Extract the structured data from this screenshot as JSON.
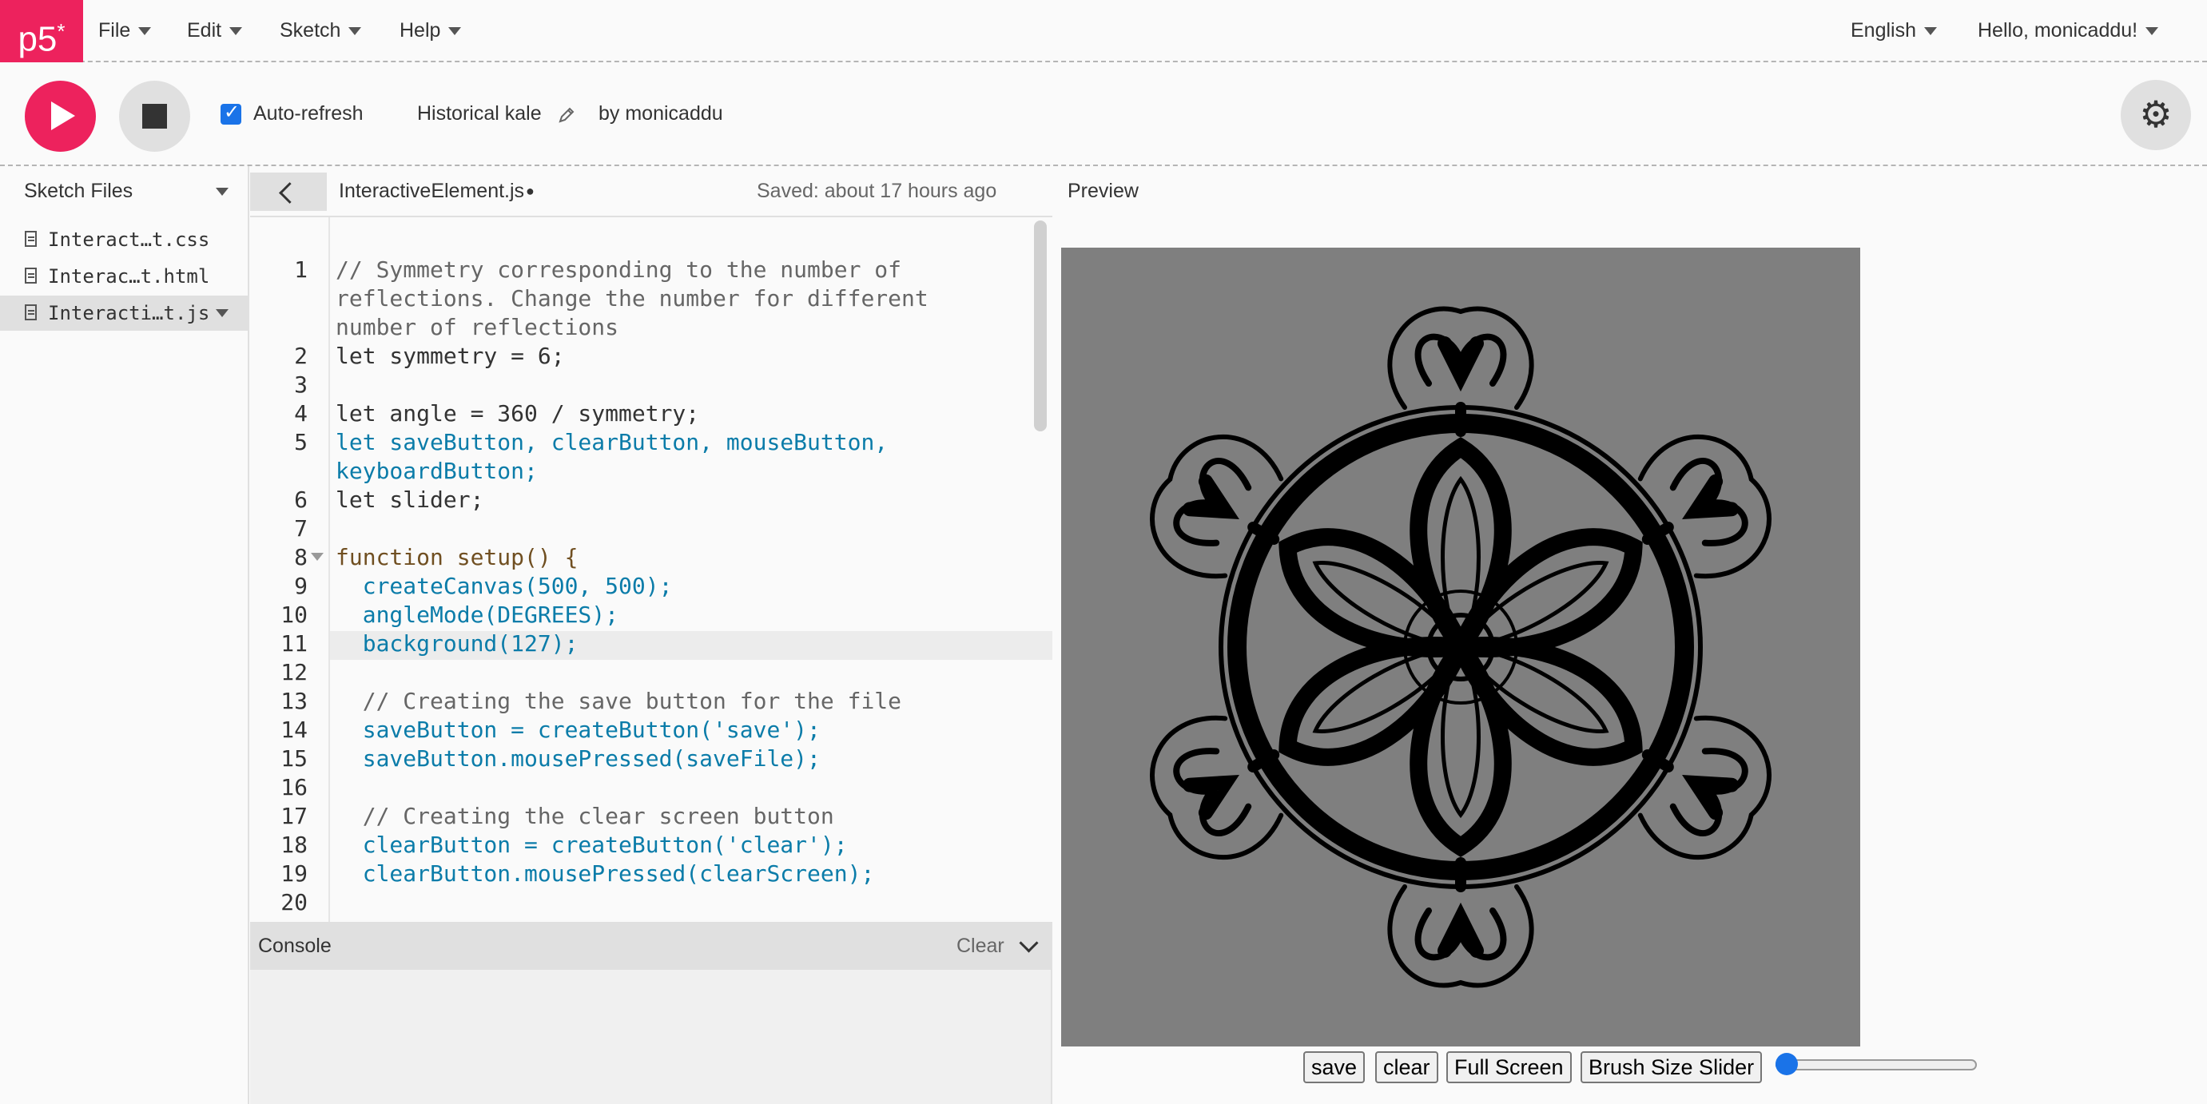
{
  "nav": {
    "logo": "p5",
    "logo_sup": "*",
    "menus": [
      "File",
      "Edit",
      "Sketch",
      "Help"
    ],
    "language": "English",
    "greeting": "Hello, monicaddu!"
  },
  "toolbar": {
    "auto_refresh_label": "Auto-refresh",
    "auto_refresh_checked": true,
    "sketch_name": "Historical kale",
    "author": "by monicaddu"
  },
  "sidebar": {
    "title": "Sketch Files",
    "files": [
      "Interact…t.css",
      "Interac…t.html",
      "Interacti…t.js"
    ],
    "selected_index": 2
  },
  "editor": {
    "filename": "InteractiveElement.js",
    "status": "Saved: about 17 hours ago",
    "line_numbers": [
      "1",
      "2",
      "3",
      "4",
      "5",
      "6",
      "7",
      "8",
      "9",
      "10",
      "11",
      "12",
      "13",
      "14",
      "15",
      "16",
      "17",
      "18",
      "19",
      "20"
    ],
    "lines": [
      "// Symmetry corresponding to the number of",
      "reflections. Change the number for different",
      "number of reflections",
      "let symmetry = 6;",
      "",
      "let angle = 360 / symmetry;",
      "let saveButton, clearButton, mouseButton,",
      "keyboardButton;",
      "let slider;",
      "",
      "function setup() {",
      "  createCanvas(500, 500);",
      "  angleMode(DEGREES);",
      "  background(127);",
      "",
      "  // Creating the save button for the file",
      "  saveButton = createButton('save');",
      "  saveButton.mousePressed(saveFile);",
      "",
      "  // Creating the clear screen button",
      "  clearButton = createButton('clear');",
      "  clearButton.mousePressed(clearScreen);"
    ]
  },
  "console": {
    "title": "Console",
    "clear": "Clear"
  },
  "preview": {
    "title": "Preview",
    "canvas_background": "#7f7f7f",
    "buttons": [
      "save",
      "clear",
      "Full Screen",
      "Brush Size Slider"
    ],
    "slider_value": 0
  },
  "colors": {
    "accent": "#ed225d",
    "keyword": "#704f21",
    "identifier": "#0b7ca9",
    "comment": "#666666",
    "string": "#47820a",
    "constant": "#d52889"
  }
}
